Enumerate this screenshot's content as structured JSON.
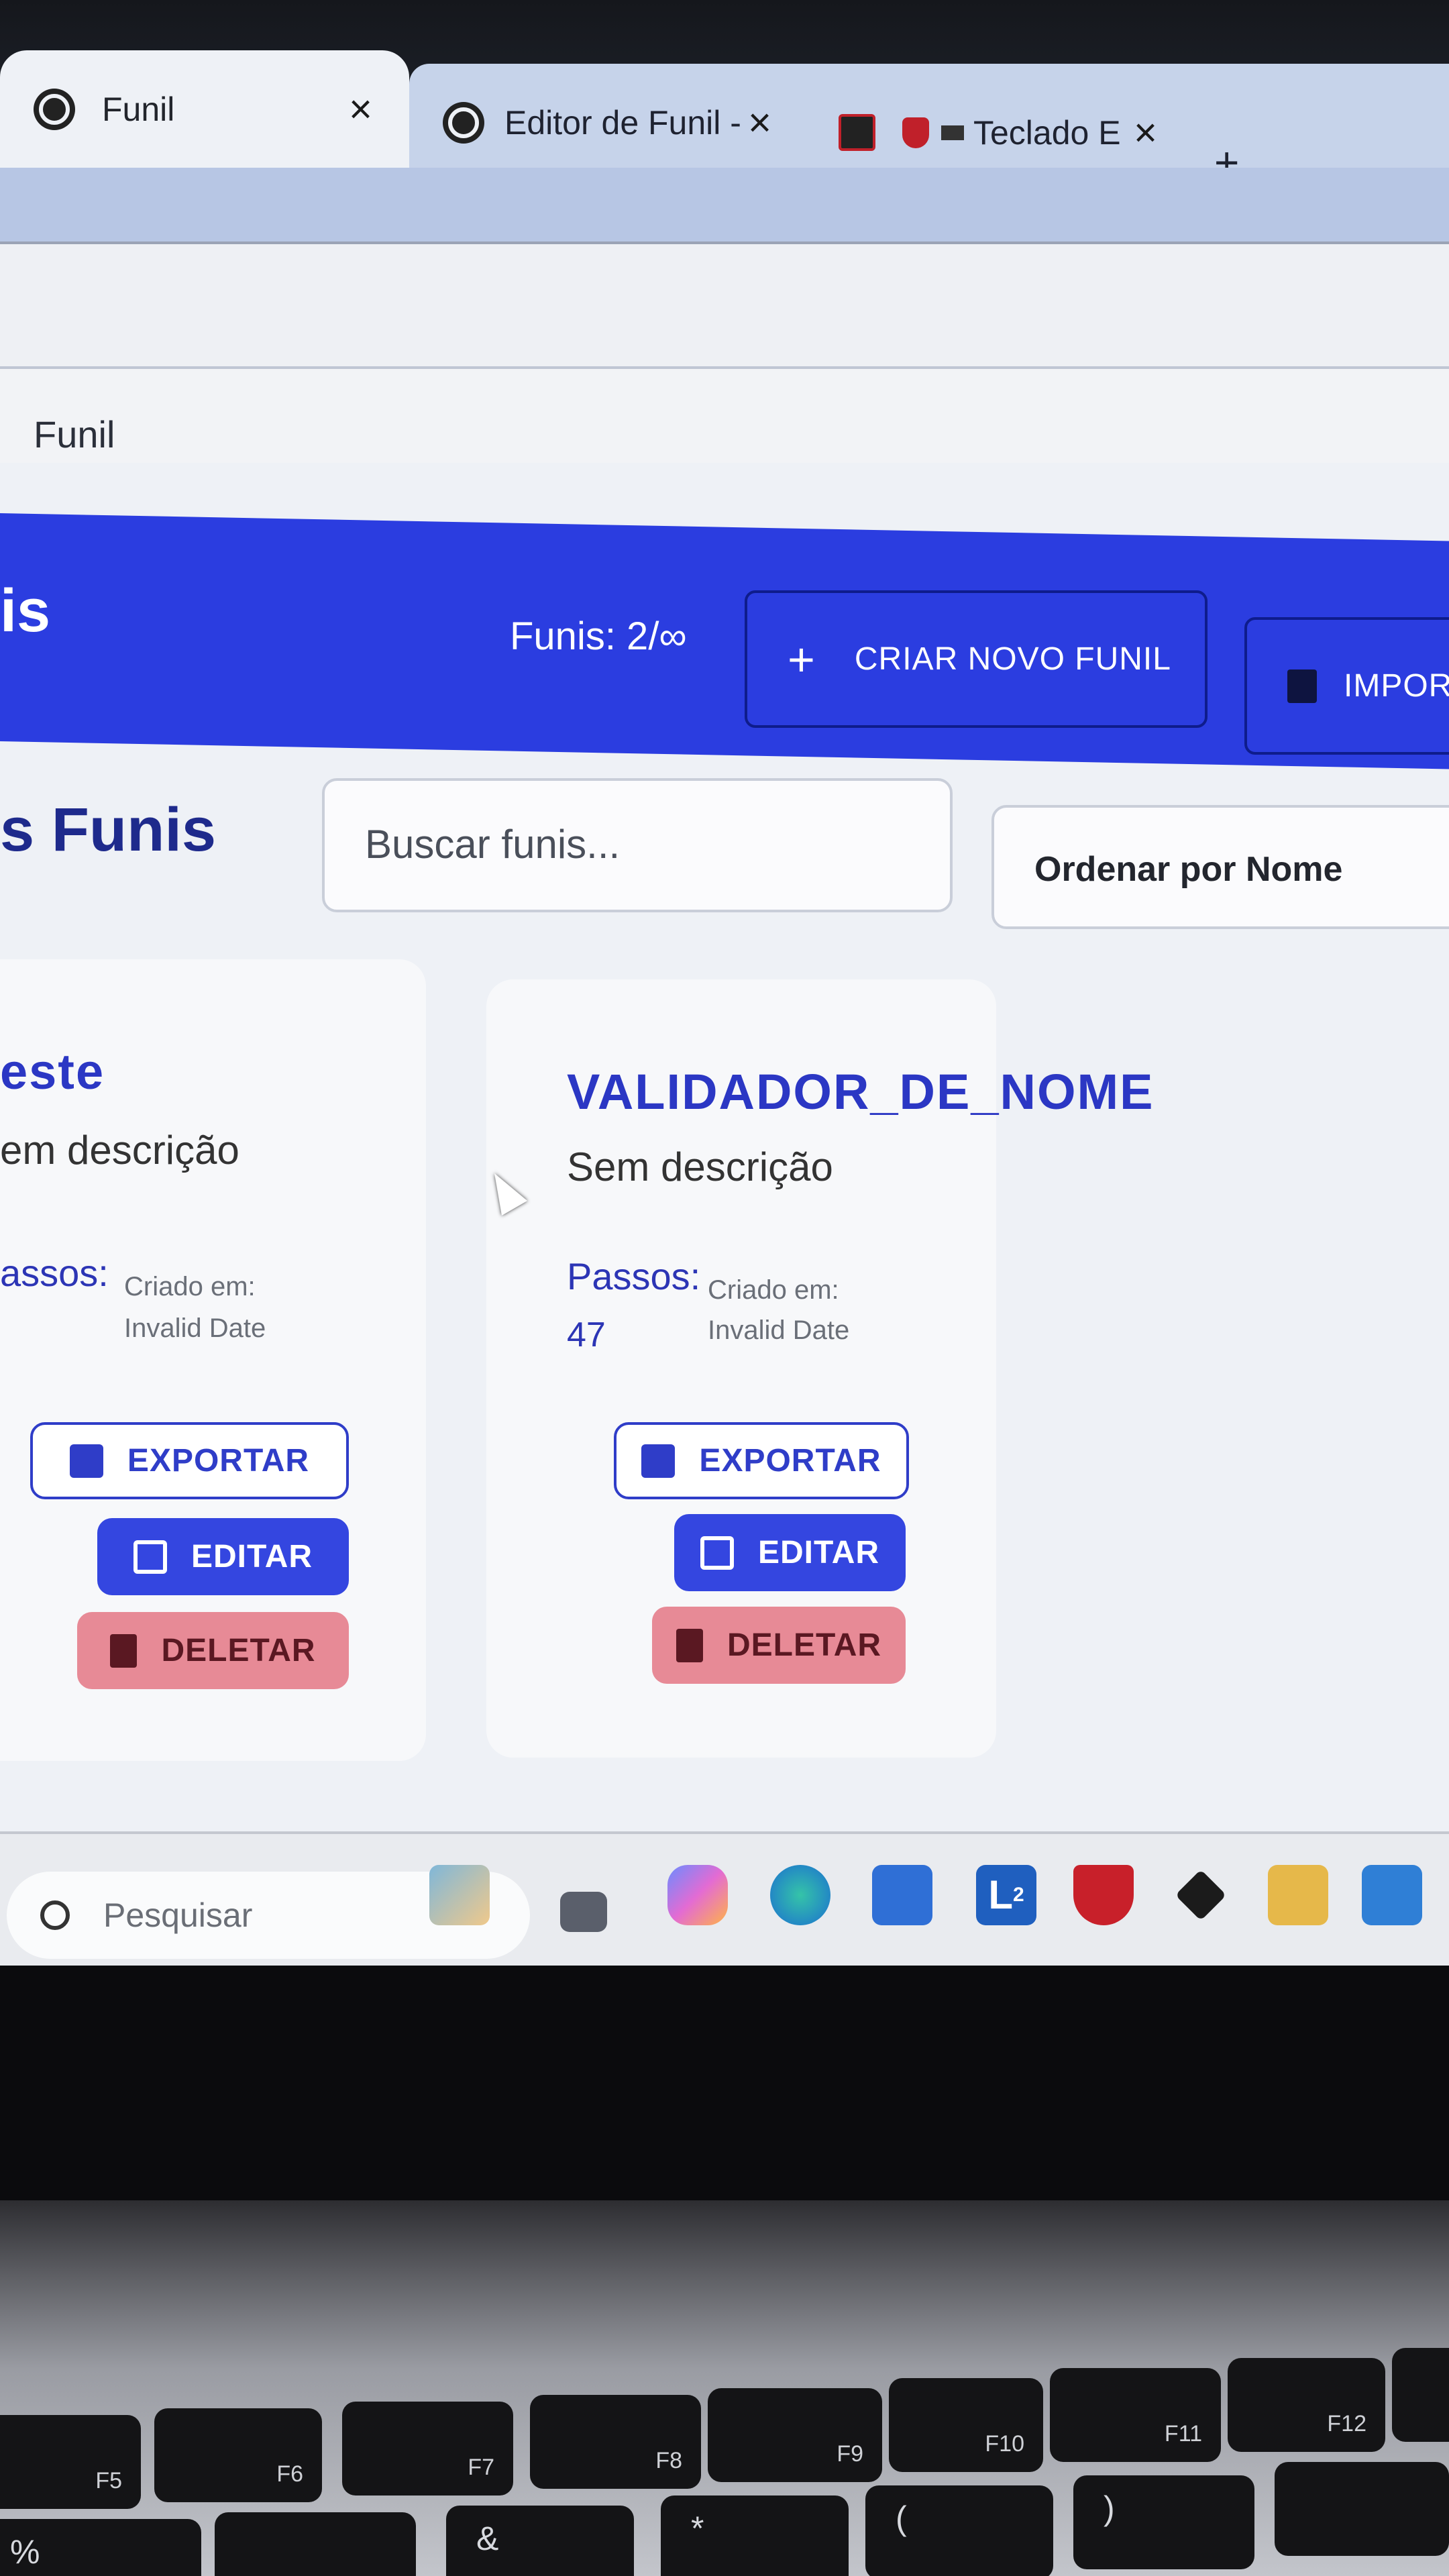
{
  "browser": {
    "tabs": [
      {
        "label": "Funil",
        "close": "×"
      },
      {
        "label": "Editor de Funil -",
        "close": "×"
      },
      {
        "label": "Teclado E",
        "close": "×"
      }
    ],
    "new_tab": "+",
    "breadcrumb": "Funil"
  },
  "header": {
    "title": "is",
    "counter": "Funis: 2/∞",
    "create_label": "CRIAR NOVO FUNIL",
    "import_label": "IMPOR"
  },
  "list": {
    "section_title": "s Funis",
    "search_placeholder": "Buscar funis...",
    "sort_label": "Ordenar por Nome"
  },
  "cards": [
    {
      "title": "este",
      "description": "em descrição",
      "passos_label": "assos:",
      "created_label": "Criado em:",
      "created_value": "Invalid Date",
      "export_label": "EXPORTAR",
      "edit_label": "EDITAR",
      "delete_label": "DELETAR"
    },
    {
      "title": "VALIDADOR_DE_NOME",
      "description": "Sem descrição",
      "passos_label": "Passos:",
      "passos_count": "47",
      "created_label": "Criado em:",
      "created_value": "Invalid Date",
      "export_label": "EXPORTAR",
      "edit_label": "EDITAR",
      "delete_label": "DELETAR"
    }
  ],
  "taskbar": {
    "search_placeholder": "Pesquisar",
    "icons": [
      "landscape-widget-icon",
      "file-explorer-icon",
      "copilot-icon",
      "edge-icon",
      "store-icon",
      "lenovo-icon",
      "mcafee-icon",
      "dropbox-icon",
      "folder-icon",
      "app-x-icon"
    ],
    "badge": "2"
  },
  "keyboard": {
    "fkeys": [
      "F5",
      "F6",
      "F7",
      "F8",
      "F9",
      "F10",
      "F11",
      "F12"
    ],
    "row2": [
      "%",
      "&",
      "*",
      "(",
      ")"
    ]
  },
  "colors": {
    "brand": "#2b3de0",
    "title_blue": "#2b37c4",
    "delete_pink": "#e78a96"
  }
}
